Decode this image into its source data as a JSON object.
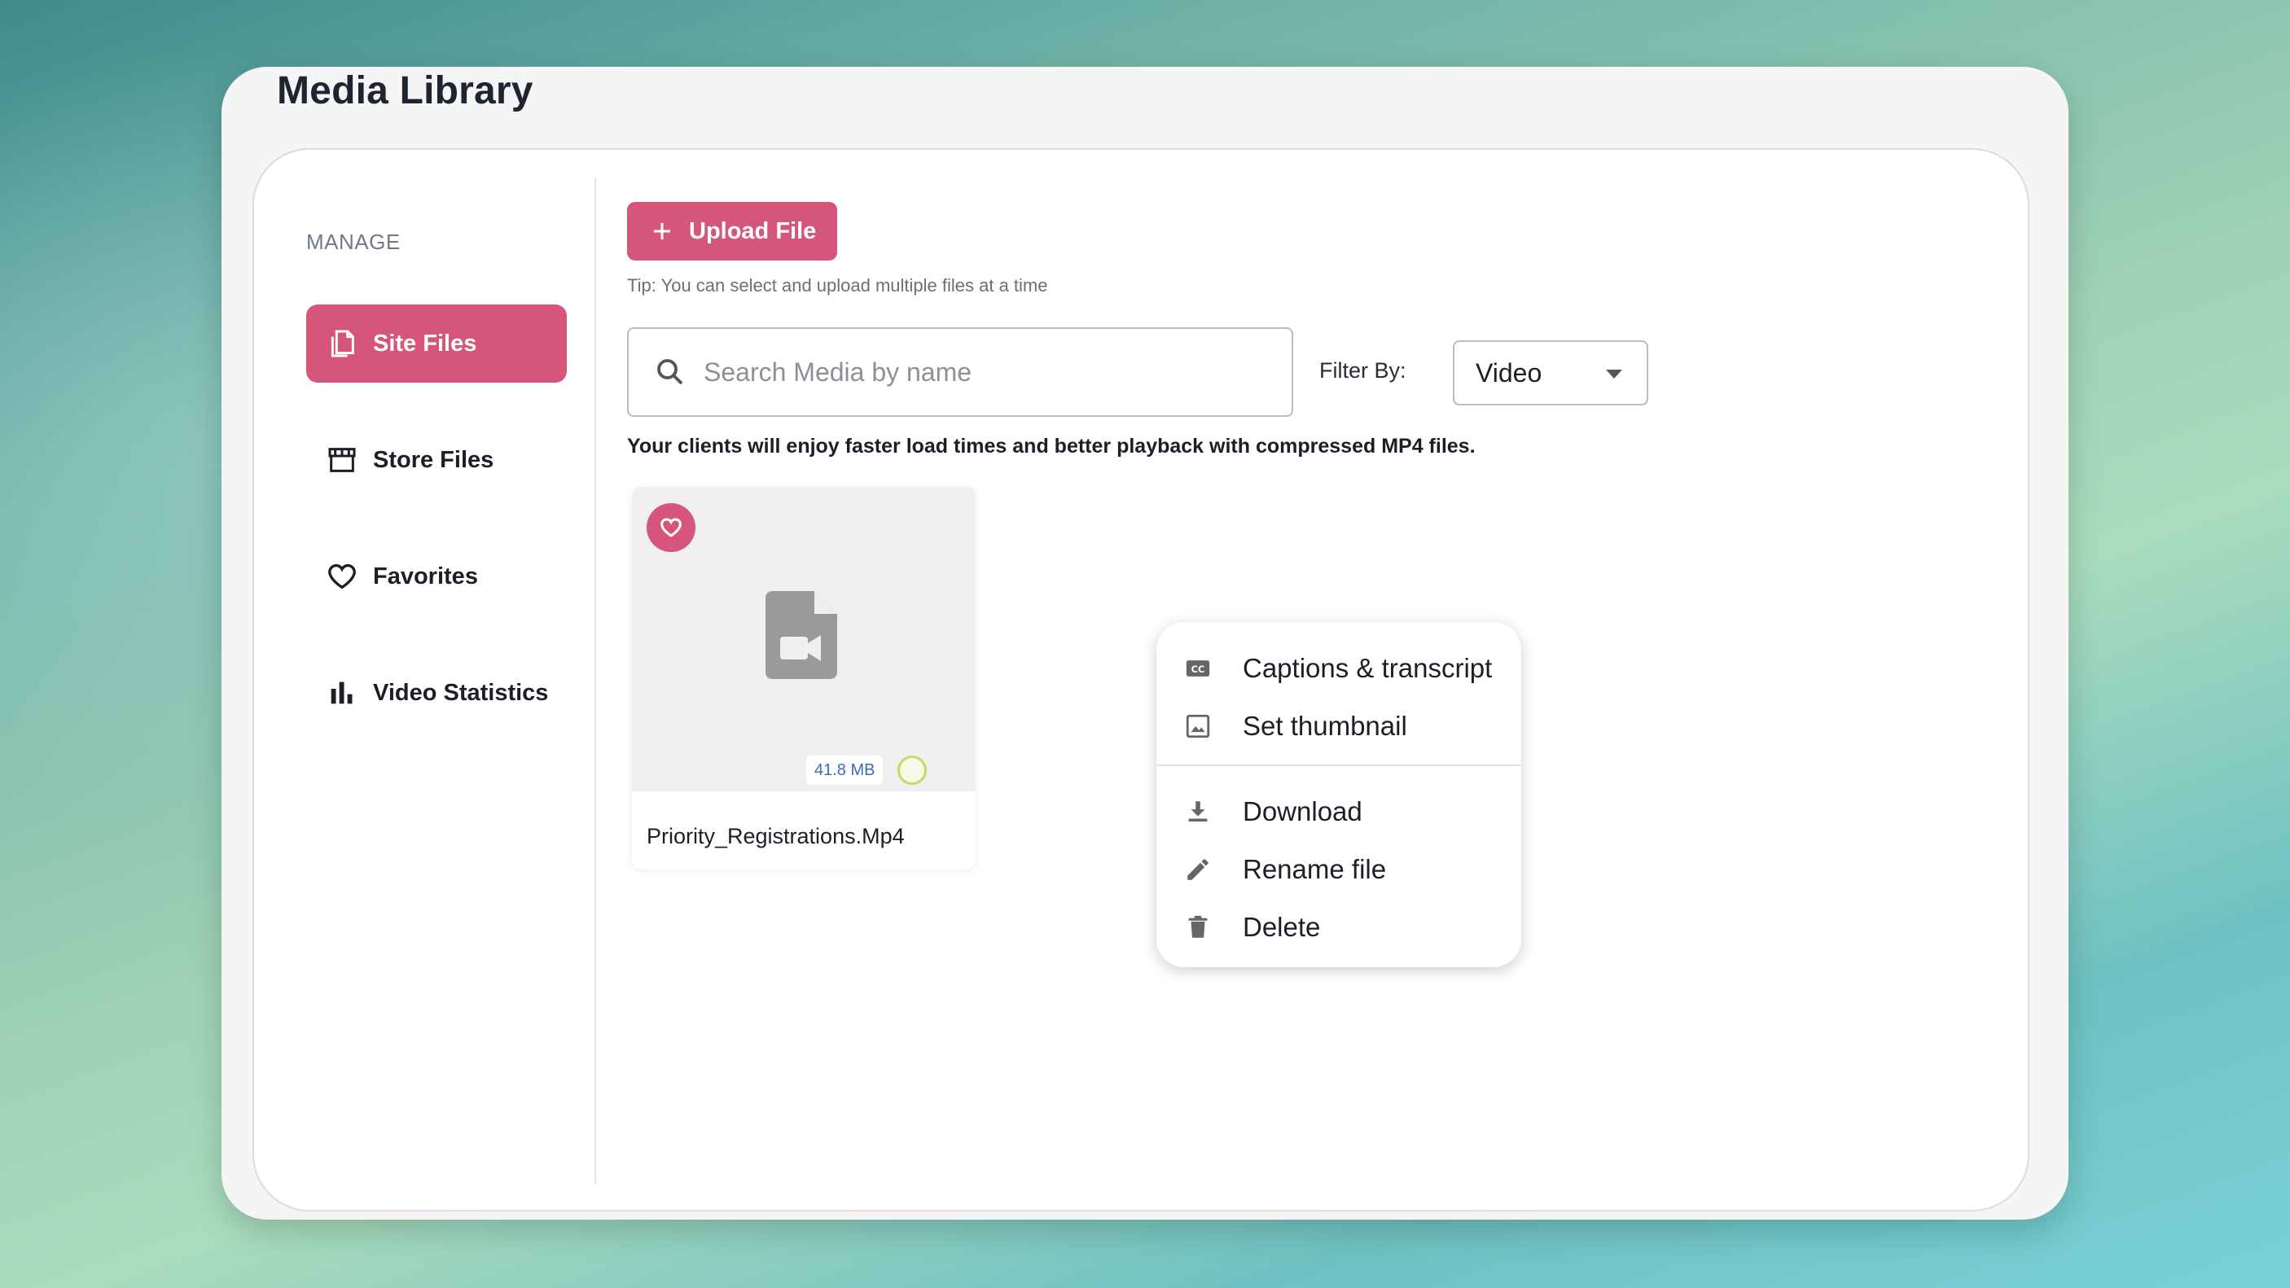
{
  "app": {
    "title": "Media Library"
  },
  "sidebar": {
    "section_label": "MANAGE",
    "items": [
      {
        "label": "Site Files",
        "icon": "copy-icon",
        "active": true
      },
      {
        "label": "Store Files",
        "icon": "store-icon",
        "active": false
      },
      {
        "label": "Favorites",
        "icon": "heart-icon",
        "active": false
      },
      {
        "label": "Video Statistics",
        "icon": "bar-chart-icon",
        "active": false
      }
    ]
  },
  "toolbar": {
    "upload_label": "Upload File",
    "tip": "Tip: You can select and upload multiple files at a time"
  },
  "search": {
    "placeholder": "Search Media by name",
    "value": ""
  },
  "filter": {
    "label": "Filter By:",
    "selected": "Video"
  },
  "notice": "Your clients will enjoy faster load times and better playback with compressed MP4 files.",
  "files": [
    {
      "name": "Priority_Registrations.Mp4",
      "size": "41.8 MB",
      "favorite": true
    }
  ],
  "context_menu": {
    "items": [
      {
        "label": "Captions & transcript",
        "icon": "closed-captions-icon"
      },
      {
        "label": "Set thumbnail",
        "icon": "image-icon"
      },
      {
        "label": "Download",
        "icon": "download-icon"
      },
      {
        "label": "Rename file",
        "icon": "pencil-icon"
      },
      {
        "label": "Delete",
        "icon": "trash-icon"
      }
    ]
  },
  "colors": {
    "accent": "#d6557a",
    "text": "#1c1f26",
    "muted": "#6f7a88"
  }
}
